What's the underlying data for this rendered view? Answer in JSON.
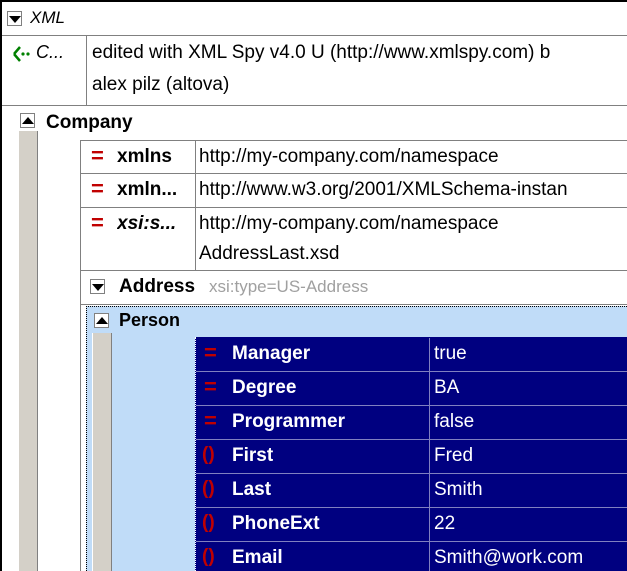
{
  "xml_node": {
    "label": "XML"
  },
  "comment": {
    "label": "C...",
    "text_line1": "edited with XML Spy v4.0 U (http://www.xmlspy.com) b",
    "text_line2": "alex pilz (altova)"
  },
  "company": {
    "label": "Company",
    "attributes": [
      {
        "name": "xmlns",
        "value": "http://my-company.com/namespace"
      },
      {
        "name": "xmln...",
        "value": "http://www.w3.org/2001/XMLSchema-instan"
      },
      {
        "name": "xsi:s...",
        "value": "http://my-company.com/namespace",
        "value2": "AddressLast.xsd"
      }
    ]
  },
  "address": {
    "label": "Address",
    "type_text": "xsi:type=US-Address"
  },
  "person": {
    "label": "Person",
    "rows": [
      {
        "kind": "attribute",
        "icon": "=",
        "name": "Manager",
        "value": "true"
      },
      {
        "kind": "attribute",
        "icon": "=",
        "name": "Degree",
        "value": "BA"
      },
      {
        "kind": "attribute",
        "icon": "=",
        "name": "Programmer",
        "value": "false"
      },
      {
        "kind": "element",
        "icon": "()",
        "name": "First",
        "value": "Fred"
      },
      {
        "kind": "element",
        "icon": "()",
        "name": "Last",
        "value": "Smith"
      },
      {
        "kind": "element",
        "icon": "()",
        "name": "PhoneExt",
        "value": "22"
      },
      {
        "kind": "element",
        "icon": "()",
        "name": "Email",
        "value": "Smith@work.com"
      }
    ]
  },
  "colors": {
    "selection": "#000080",
    "person_bg": "#c0dcf8",
    "attr_icon": "#c00000",
    "gutter": "#d4d0c8"
  }
}
